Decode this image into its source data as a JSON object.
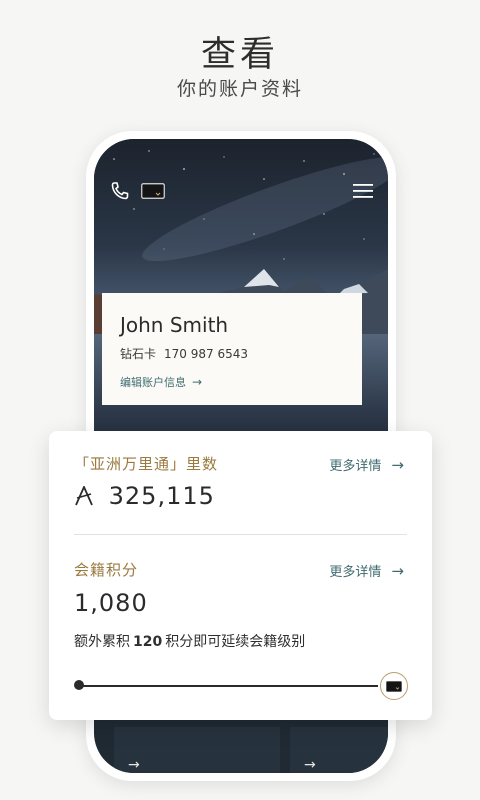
{
  "header": {
    "title": "查看",
    "subtitle": "你的账户资料"
  },
  "profile": {
    "name": "John Smith",
    "tier": "钻石卡",
    "member_number": "170 987 6543",
    "edit_label": "编辑账户信息",
    "edit_arrow": "→"
  },
  "miles": {
    "title": "「亚洲万里通」里数",
    "link": "更多详情",
    "link_arrow": "→",
    "currency_symbol": "A",
    "value": "325,115"
  },
  "membership": {
    "title": "会籍积分",
    "link": "更多详情",
    "link_arrow": "→",
    "value": "1,080",
    "extra_prefix": "额外累积",
    "extra_points": "120",
    "extra_suffix": "积分即可延续会籍级别",
    "progress": 0.98
  },
  "tiles": {
    "arrow": "→"
  },
  "icons": [
    "phone-icon",
    "membership-card-icon",
    "menu-icon",
    "arrow-right-icon"
  ],
  "colors": {
    "gold": "#9a7a3f",
    "teal": "#3f6b6f",
    "text": "#2b2b2b"
  }
}
